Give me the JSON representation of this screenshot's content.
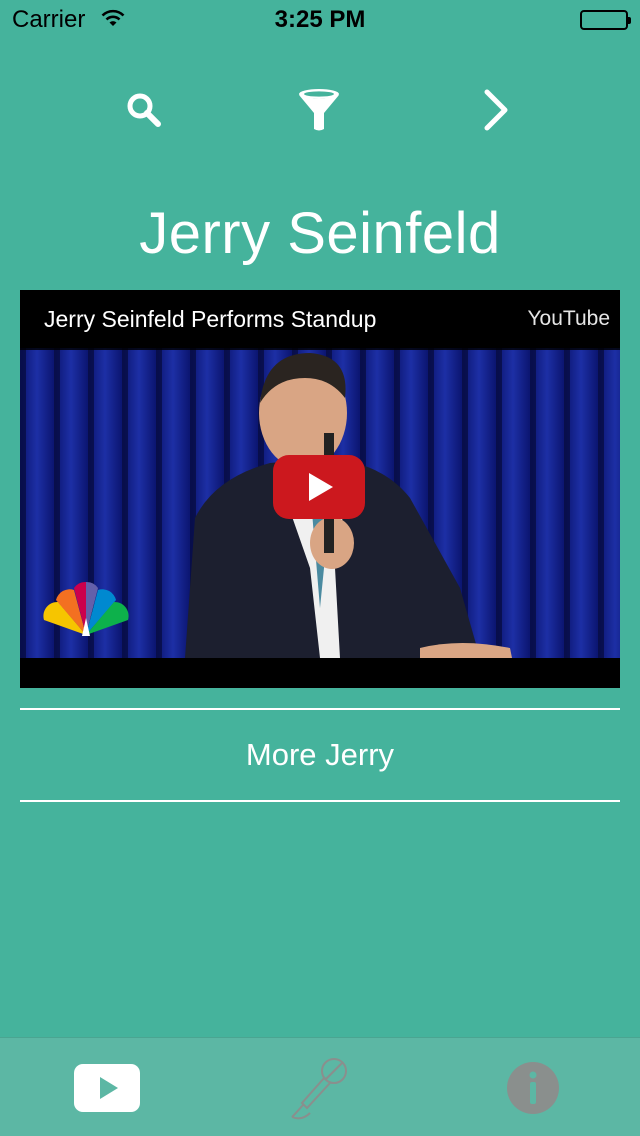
{
  "status_bar": {
    "carrier": "Carrier",
    "time": "3:25 PM"
  },
  "nav": {
    "icons": [
      "search-icon",
      "filter-icon",
      "chevron-right-icon"
    ]
  },
  "artist": {
    "name": "Jerry Seinfeld"
  },
  "video": {
    "title": "Jerry Seinfeld Performs Standup",
    "source": "YouTube",
    "play_icon": "play-icon",
    "logo": "peacock-logo"
  },
  "more": {
    "label": "More Jerry"
  },
  "tabs": [
    {
      "icon": "youtube-icon",
      "selected": true
    },
    {
      "icon": "microphone-icon",
      "selected": false
    },
    {
      "icon": "info-icon",
      "selected": false
    }
  ],
  "colors": {
    "background": "#45b39c",
    "tab_bar": "#5cb7a4",
    "play_red": "#cc181e",
    "tab_inactive": "#8a8f8d"
  }
}
